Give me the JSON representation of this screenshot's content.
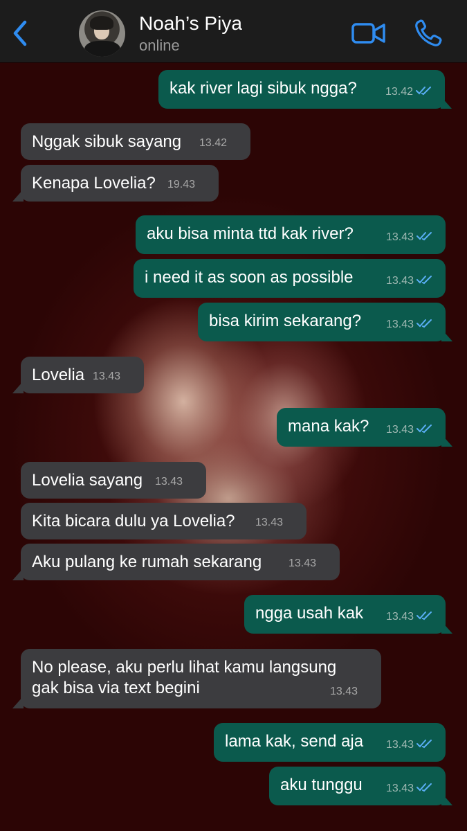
{
  "header": {
    "contact_name": "Noah’s Piya",
    "status": "online",
    "icons": {
      "back": "chevron-left-icon",
      "video": "video-camera-icon",
      "call": "phone-icon"
    },
    "accent_color": "#2f8cf0"
  },
  "colors": {
    "outgoing_bubble": "#0b5a4d",
    "incoming_bubble": "#3c3c3f",
    "read_ticks": "#5aaef5"
  },
  "messages": [
    {
      "direction": "out",
      "text": "kak river lagi sibuk ngga?",
      "time": "13.42",
      "read": true
    },
    {
      "direction": "in",
      "text": "Nggak sibuk sayang",
      "time": "13.42"
    },
    {
      "direction": "in",
      "text": "Kenapa Lovelia?",
      "time": "19.43"
    },
    {
      "direction": "out",
      "text": "aku bisa minta ttd kak river?",
      "time": "13.43",
      "read": true
    },
    {
      "direction": "out",
      "text": "i need it as soon as possible",
      "time": "13.43",
      "read": true
    },
    {
      "direction": "out",
      "text": "bisa kirim sekarang?",
      "time": "13.43",
      "read": true
    },
    {
      "direction": "in",
      "text": "Lovelia",
      "time": "13.43"
    },
    {
      "direction": "out",
      "text": "mana kak?",
      "time": "13.43",
      "read": true
    },
    {
      "direction": "in",
      "text": "Lovelia sayang",
      "time": "13.43"
    },
    {
      "direction": "in",
      "text": "Kita bicara dulu ya Lovelia?",
      "time": "13.43"
    },
    {
      "direction": "in",
      "text": "Aku pulang ke rumah sekarang",
      "time": "13.43"
    },
    {
      "direction": "out",
      "text": "ngga usah kak",
      "time": "13.43",
      "read": true
    },
    {
      "direction": "in",
      "text": "No please, aku perlu lihat kamu langsung gak bisa via text begini",
      "time": "13.43"
    },
    {
      "direction": "out",
      "text": "lama kak, send aja",
      "time": "13.43",
      "read": true
    },
    {
      "direction": "out",
      "text": "aku tunggu",
      "time": "13.43",
      "read": true
    }
  ]
}
